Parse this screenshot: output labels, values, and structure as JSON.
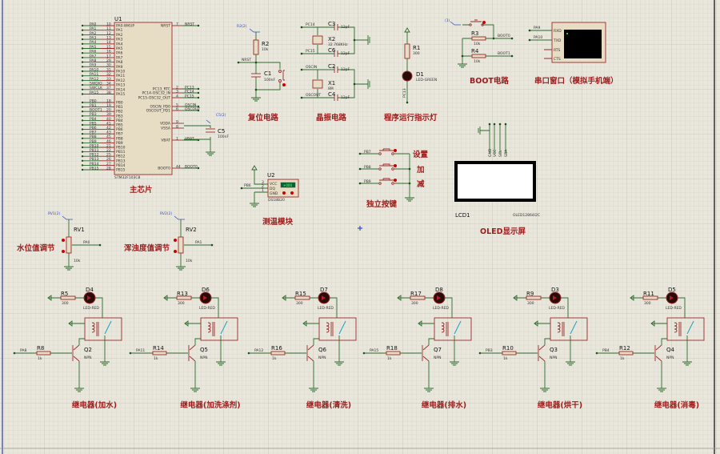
{
  "colors": {
    "canvas": "#e9e7dc",
    "grid": "#cfccbf",
    "wire": "#2c6b2c",
    "component": "#9a2a2a",
    "label": "#9c1c1c",
    "probe": "#3050c0"
  },
  "mcu": {
    "ref": "U1",
    "part": "STM32F103C8",
    "section_label": "主芯片",
    "left_pins": [
      {
        "name": "PA0-WKUP",
        "num": "10",
        "net": "PA0"
      },
      {
        "name": "PA1",
        "num": "11",
        "net": "PA1"
      },
      {
        "name": "PA2",
        "num": "12",
        "net": "PA2"
      },
      {
        "name": "PA3",
        "num": "13",
        "net": "PA3"
      },
      {
        "name": "PA4",
        "num": "14",
        "net": "PA4"
      },
      {
        "name": "PA5",
        "num": "15",
        "net": "PA5"
      },
      {
        "name": "PA6",
        "num": "16",
        "net": "PA6"
      },
      {
        "name": "PA7",
        "num": "17",
        "net": "PA7"
      },
      {
        "name": "PA8",
        "num": "29",
        "net": "PA8"
      },
      {
        "name": "PA9",
        "num": "30",
        "net": "PA9"
      },
      {
        "name": "PA10",
        "num": "31",
        "net": "PA10"
      },
      {
        "name": "PA11",
        "num": "32",
        "net": "PA11"
      },
      {
        "name": "PA12",
        "num": "33",
        "net": "PA12"
      },
      {
        "name": "PA13",
        "num": "34",
        "net": "SWDIO"
      },
      {
        "name": "PA14",
        "num": "37",
        "net": "SWCLK"
      },
      {
        "name": "PA15",
        "num": "38",
        "net": "PA15"
      },
      {
        "name": "PB0",
        "num": "18",
        "net": "PB0"
      },
      {
        "name": "PB1",
        "num": "19",
        "net": "PB1"
      },
      {
        "name": "PB2",
        "num": "20",
        "net": "BOOT1"
      },
      {
        "name": "PB3",
        "num": "39",
        "net": "PB3"
      },
      {
        "name": "PB4",
        "num": "40",
        "net": "PB4"
      },
      {
        "name": "PB5",
        "num": "41",
        "net": "PB5"
      },
      {
        "name": "PB6",
        "num": "42",
        "net": "PB6"
      },
      {
        "name": "PB7",
        "num": "43",
        "net": "PB7"
      },
      {
        "name": "PB8",
        "num": "45",
        "net": "PB8"
      },
      {
        "name": "PB9",
        "num": "46",
        "net": "PB9"
      },
      {
        "name": "PB10",
        "num": "21",
        "net": "PB10"
      },
      {
        "name": "PB11",
        "num": "22",
        "net": "PB11"
      },
      {
        "name": "PB12",
        "num": "25",
        "net": "PB12"
      },
      {
        "name": "PB13",
        "num": "26",
        "net": "PB13"
      },
      {
        "name": "PB14",
        "num": "27",
        "net": "PB14"
      },
      {
        "name": "PB15",
        "num": "28",
        "net": "PB15"
      }
    ],
    "right_pins": [
      {
        "name": "NRST",
        "num": "7",
        "net": "NRST"
      },
      {
        "name": "PC13_RTC",
        "num": "2",
        "net": "PC13"
      },
      {
        "name": "PC14-OSC32_IN",
        "num": "3",
        "net": "PC14"
      },
      {
        "name": "PC15-OSC32_OUT",
        "num": "4",
        "net": "PC15"
      },
      {
        "name": "OSCIN_PD0",
        "num": "5",
        "net": "OSCIN"
      },
      {
        "name": "OSCOUT_PD1",
        "num": "6",
        "net": "OSCOUT"
      },
      {
        "name": "VDDA",
        "num": "9",
        "net": ""
      },
      {
        "name": "VSSA",
        "num": "8",
        "net": ""
      },
      {
        "name": "VBAT",
        "num": "1",
        "net": "VBAT"
      },
      {
        "name": "BOOT0",
        "num": "44",
        "net": "BOOT0"
      }
    ],
    "c5": {
      "ref": "C5",
      "value": "100nF",
      "probe": "C5(2)"
    }
  },
  "reset": {
    "probe": "R2(2)",
    "r_ref": "R2",
    "r_val": "10k",
    "net": "NRST",
    "c_ref": "C1",
    "c_val": "100nF",
    "section_label": "复位电路"
  },
  "crystal": {
    "nets": [
      "PC14",
      "PC15",
      "OSCIN",
      "OSCOUT"
    ],
    "x2_ref": "X2",
    "x2_val": "32.768KHz",
    "x1_ref": "X1",
    "x1_val": "8M",
    "caps": [
      {
        "ref": "C3",
        "val": "12pF"
      },
      {
        "ref": "C6",
        "val": "12pF"
      },
      {
        "ref": "C2",
        "val": "12pF"
      },
      {
        "ref": "C4",
        "val": "12pF"
      }
    ],
    "section_label": "晶振电路"
  },
  "run_led": {
    "r_ref": "R1",
    "r_val": "300",
    "d_ref": "D1",
    "d_val": "LED-GREEN",
    "net": "PC13",
    "section_label": "程序运行指示灯"
  },
  "boot": {
    "probe": "(1)",
    "r3_ref": "R3",
    "r3_val": "10k",
    "r4_ref": "R4",
    "r4_val": "10k",
    "net0": "BOOT0",
    "net1": "BOOT1",
    "section_label": "BOOT电路"
  },
  "serial": {
    "pins": [
      "RXD",
      "TXD",
      "RTS",
      "CTS"
    ],
    "nets": [
      "PA9",
      "PA10"
    ],
    "section_label": "串口窗口（模拟手机端）"
  },
  "temp": {
    "ref": "U2",
    "part": "DS18B20",
    "pins": [
      "VCC",
      "DQ",
      "GND"
    ],
    "pin_nums": [
      "3",
      "2",
      "1"
    ],
    "reading": "+000",
    "net": "PB6",
    "section_label": "测温模块"
  },
  "keys": {
    "nets": [
      "PB7",
      "PB8",
      "PB9"
    ],
    "labels": [
      "设置",
      "加",
      "减"
    ],
    "section_label": "独立按键"
  },
  "oled": {
    "ref": "LCD1",
    "part": "OLED12864I2C",
    "pins": [
      "GND",
      "VCC",
      "SCL",
      "SDA"
    ],
    "section_label": "OLED显示屏"
  },
  "pots": [
    {
      "probe": "RV1(2)",
      "ref": "RV1",
      "val": "10k",
      "net": "PA0",
      "section_label": "水位值调节"
    },
    {
      "probe": "RV2(2)",
      "ref": "RV2",
      "val": "10k",
      "net": "PA1",
      "section_label": "浑浊度值调节"
    }
  ],
  "relays": [
    {
      "net": "PA8",
      "rb": "R8",
      "rb_val": "1k",
      "q": "Q2",
      "q_type": "NPN",
      "rl": "R5",
      "rl_val": "300",
      "d": "D4",
      "d_val": "LED-RED",
      "label": "继电器(加水)"
    },
    {
      "net": "PA11",
      "rb": "R14",
      "rb_val": "1k",
      "q": "Q5",
      "q_type": "NPN",
      "rl": "R13",
      "rl_val": "300",
      "d": "D6",
      "d_val": "LED-RED",
      "label": "继电器(加洗涤剂)"
    },
    {
      "net": "PA12",
      "rb": "R16",
      "rb_val": "1k",
      "q": "Q6",
      "q_type": "NPN",
      "rl": "R15",
      "rl_val": "300",
      "d": "D7",
      "d_val": "LED-RED",
      "label": "继电器(清洗)"
    },
    {
      "net": "PA15",
      "rb": "R18",
      "rb_val": "1k",
      "q": "Q7",
      "q_type": "NPN",
      "rl": "R17",
      "rl_val": "300",
      "d": "D8",
      "d_val": "LED-RED",
      "label": "继电器(排水)"
    },
    {
      "net": "PB3",
      "rb": "R10",
      "rb_val": "1k",
      "q": "Q3",
      "q_type": "NPN",
      "rl": "R9",
      "rl_val": "300",
      "d": "D3",
      "d_val": "LED-RED",
      "label": "继电器(烘干)"
    },
    {
      "net": "PB4",
      "rb": "R12",
      "rb_val": "1k",
      "q": "Q4",
      "q_type": "NPN",
      "rl": "R11",
      "rl_val": "300",
      "d": "D5",
      "d_val": "LED-RED",
      "label": "继电器(消毒)"
    }
  ]
}
